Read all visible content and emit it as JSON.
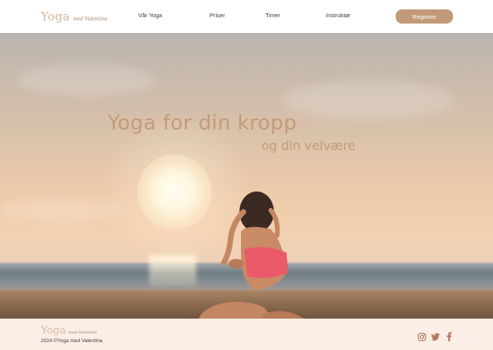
{
  "header": {
    "logo_main": "Yoga",
    "logo_sub": "med Valentina",
    "nav": [
      "Vår Yoga",
      "Priser",
      "Timer",
      "Instruktør"
    ],
    "register_label": "Registrer"
  },
  "hero": {
    "title": "Yoga for din kropp",
    "subtitle": "og din velvære"
  },
  "footer": {
    "logo_main": "Yoga",
    "logo_sub": "med Valentina",
    "copyright": "2024 ©Yoga med Valentina",
    "social_icons": [
      "instagram-icon",
      "twitter-icon",
      "facebook-icon"
    ]
  },
  "colors": {
    "accent": "#c19a77",
    "title": "#c59b78",
    "footer_bg": "#fbeee6"
  }
}
